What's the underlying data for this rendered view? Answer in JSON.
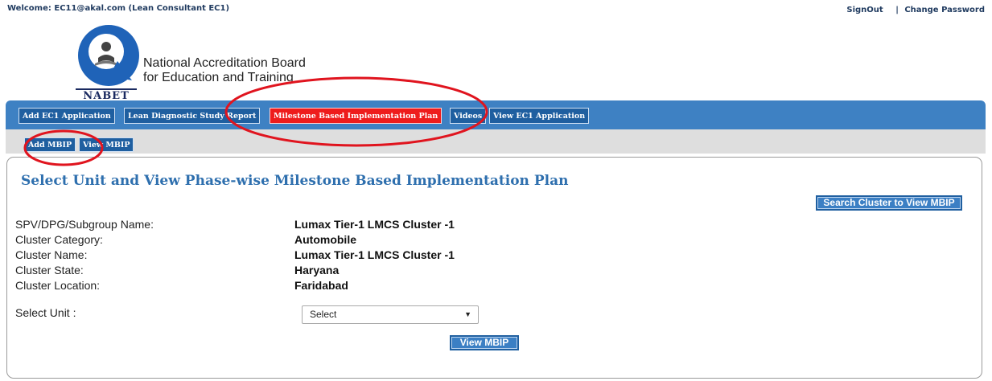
{
  "header": {
    "welcome": "Welcome: EC11@akal.com (Lean Consultant EC1)",
    "signout": "SignOut",
    "separator": "|",
    "change_password": "Change Password"
  },
  "logo": {
    "acronym": "NABET",
    "line1": "National Accreditation Board",
    "line2": "for Education and Training"
  },
  "nav": {
    "tabs": [
      {
        "label": "Add EC1 Application",
        "active": false
      },
      {
        "label": "Lean Diagnostic Study Report",
        "active": false
      },
      {
        "label": "Milestone Based Implementation Plan",
        "active": true
      },
      {
        "label": "Videos",
        "active": false
      },
      {
        "label": "View EC1 Application",
        "active": false
      }
    ],
    "subtabs": [
      {
        "label": "Add MBIP"
      },
      {
        "label": "View MBIP"
      }
    ]
  },
  "main": {
    "title": "Select Unit and View Phase-wise Milestone Based Implementation Plan",
    "search_button": "Search Cluster to View MBIP",
    "fields": [
      {
        "label": "SPV/DPG/Subgroup Name:",
        "value": "Lumax Tier-1 LMCS Cluster -1"
      },
      {
        "label": "Cluster Category:",
        "value": "Automobile"
      },
      {
        "label": "Cluster Name:",
        "value": "Lumax Tier-1 LMCS Cluster -1"
      },
      {
        "label": "Cluster State:",
        "value": "Haryana"
      },
      {
        "label": "Cluster Location:",
        "value": "Faridabad"
      }
    ],
    "select_unit_label": "Select Unit :",
    "select_unit_value": "Select",
    "view_button": "View MBIP"
  },
  "colors": {
    "nav_blue": "#3e81c3",
    "tab_blue": "#1f5fa0",
    "active_red": "#ee1c1c",
    "title_blue": "#2e6fae",
    "annotation_red": "#e0141e"
  },
  "icons": [
    "nabet-logo",
    "dropdown-arrow-icon"
  ]
}
